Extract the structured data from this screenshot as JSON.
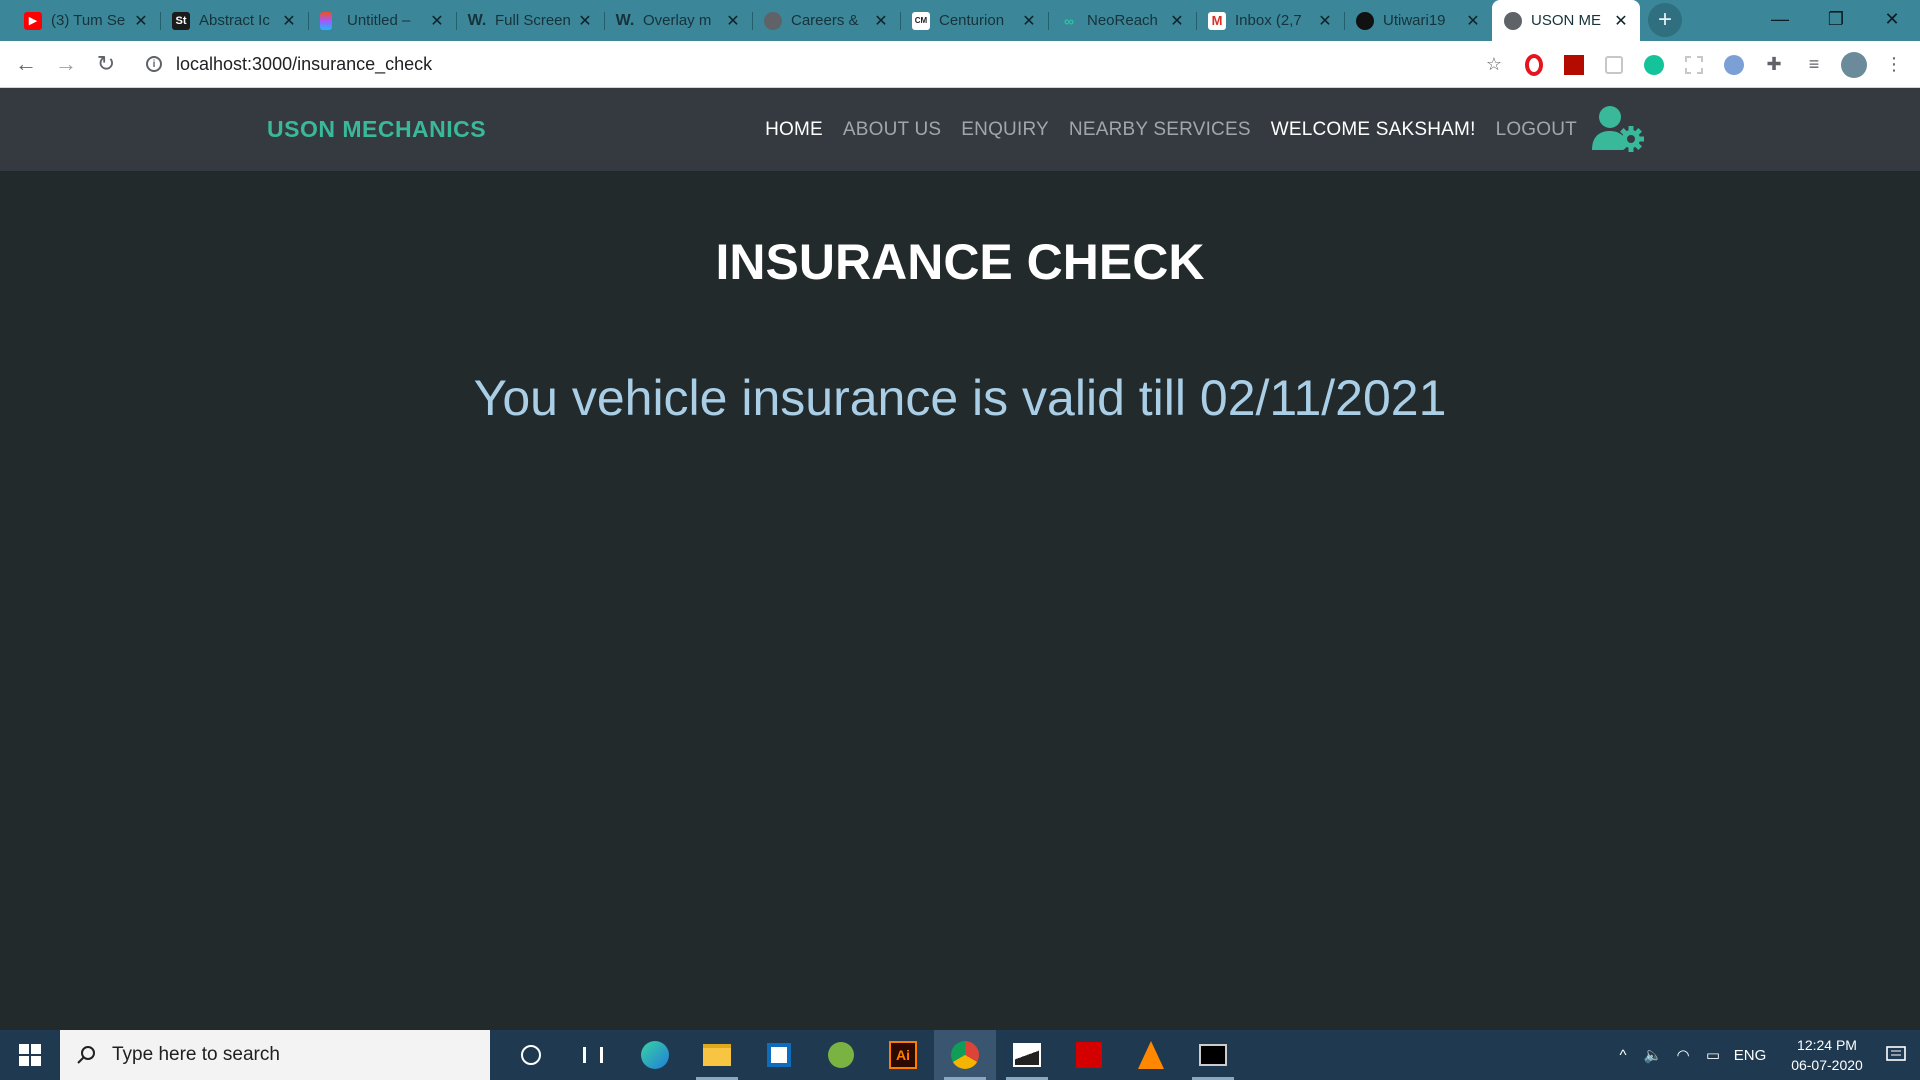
{
  "browser": {
    "tabs": [
      {
        "title": "(3) Tum Se",
        "icon": "youtube-icon",
        "color": "#ff0000"
      },
      {
        "title": "Abstract Ic",
        "icon": "st-icon",
        "color": "#1b1b1b"
      },
      {
        "title": "Untitled –",
        "icon": "figma-icon",
        "color": "#a259ff"
      },
      {
        "title": "Full Screen",
        "icon": "w-icon",
        "color": "#17323a"
      },
      {
        "title": "Overlay m",
        "icon": "w-icon",
        "color": "#17323a"
      },
      {
        "title": "Careers &",
        "icon": "globe-icon",
        "color": "#5f6368"
      },
      {
        "title": "Centurion",
        "icon": "cm-icon",
        "color": "#ffffff"
      },
      {
        "title": "NeoReach",
        "icon": "neoreach-icon",
        "color": "#2ac3a2"
      },
      {
        "title": "Inbox (2,7",
        "icon": "gmail-icon",
        "color": "#d93025"
      },
      {
        "title": "Utiwari19",
        "icon": "github-icon",
        "color": "#000000"
      },
      {
        "title": "USON ME",
        "icon": "globe-icon",
        "color": "#5f6368",
        "active": true
      }
    ],
    "url": "localhost:3000/insurance_check"
  },
  "site": {
    "brand": "USON MECHANICS",
    "nav": {
      "home": "HOME",
      "about": "ABOUT US",
      "enquiry": "ENQUIRY",
      "nearby": "NEARBY SERVICES",
      "welcome": "WELCOME SAKSHAM!",
      "logout": "LOGOUT"
    },
    "accent_color": "#3ab99a"
  },
  "page": {
    "heading": "INSURANCE CHECK",
    "message": "You vehicle insurance is valid till 02/11/2021"
  },
  "taskbar": {
    "search_placeholder": "Type here to search",
    "lang": "ENG",
    "time": "12:24 PM",
    "date": "06-07-2020"
  }
}
